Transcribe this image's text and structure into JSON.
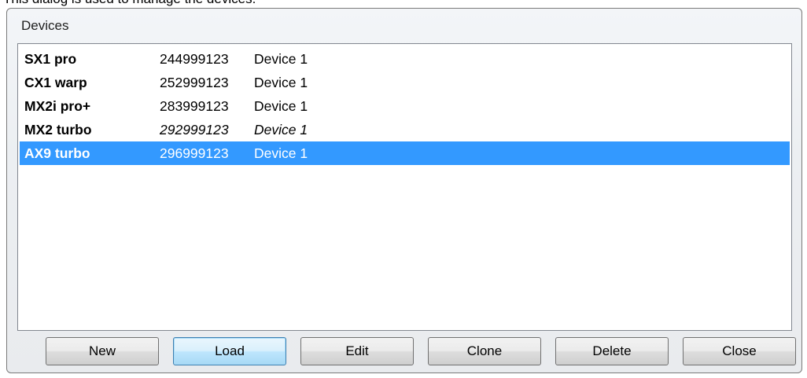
{
  "caption": "This dialog is used to manage the devices.",
  "dialog": {
    "title": "Devices"
  },
  "devices": [
    {
      "name": "SX1 pro",
      "number": "244999123",
      "device": "Device 1"
    },
    {
      "name": "CX1 warp",
      "number": "252999123",
      "device": "Device 1"
    },
    {
      "name": "MX2i pro+",
      "number": "283999123",
      "device": "Device 1"
    },
    {
      "name": "MX2 turbo",
      "number": "292999123",
      "device": "Device 1"
    },
    {
      "name": "AX9 turbo",
      "number": "296999123",
      "device": "Device 1"
    }
  ],
  "list_state": {
    "selected_index": 4,
    "italic_index": 3,
    "selection_color": "#3399ff"
  },
  "buttons": {
    "new": "New",
    "load": "Load",
    "edit": "Edit",
    "clone": "Clone",
    "delete": "Delete",
    "close": "Close"
  }
}
